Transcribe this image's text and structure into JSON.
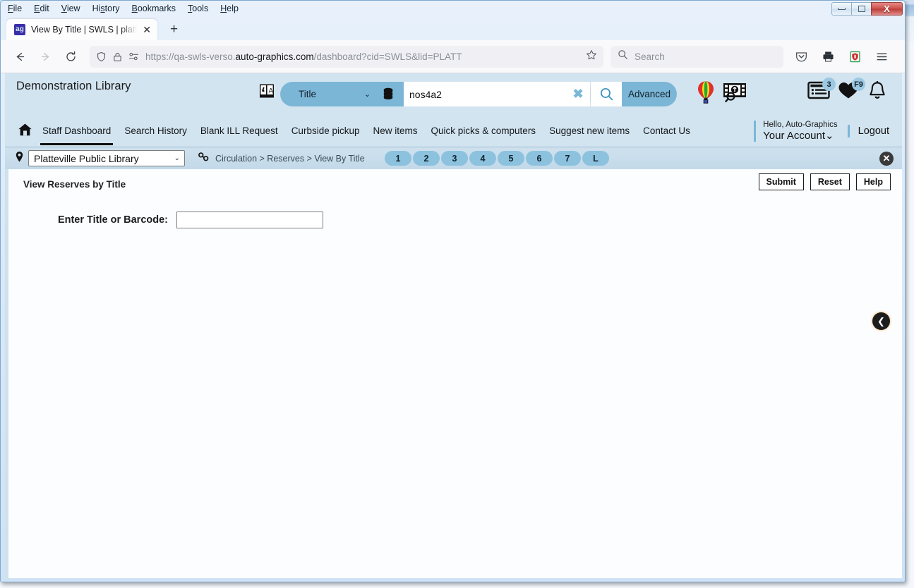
{
  "browser": {
    "menus": [
      "File",
      "Edit",
      "View",
      "History",
      "Bookmarks",
      "Tools",
      "Help"
    ],
    "window_controls": {
      "minimize": "minimize-icon",
      "restore": "restore-icon",
      "close": "X"
    },
    "tab": {
      "title": "View By Title | SWLS | platt | Aut",
      "favicon": "ag-favicon",
      "close": "✕",
      "new_tab": "+"
    },
    "nav": {
      "back": "←",
      "forward": "→",
      "reload": "↻"
    },
    "url": {
      "prefix": "https://qa-swls-verso.",
      "domain": "auto-graphics.com",
      "suffix": "/dashboard?cid=SWLS&lid=PLATT",
      "full": "https://qa-swls-verso.auto-graphics.com/dashboard?cid=SWLS&lid=PLATT"
    },
    "search": {
      "placeholder": "Search"
    },
    "toolbar_icons": [
      "pocket-icon",
      "print-icon",
      "ublock-icon",
      "hamburger-menu-icon"
    ]
  },
  "site": {
    "library_name": "Demonstration Library",
    "translate_icon": "translate-icon",
    "search": {
      "index_label": "Title",
      "caret": "⌄",
      "database_icon": "database-icon",
      "query": "nos4a2",
      "clear_label": "✖",
      "go_icon": "search-icon",
      "advanced_label": "Advanced"
    },
    "header_icons": [
      {
        "name": "balloon-icon",
        "badge": null
      },
      {
        "name": "film-search-icon",
        "badge": null
      },
      {
        "name": "my-lists-icon",
        "badge": "3"
      },
      {
        "name": "favorites-heart-icon",
        "badge": "F9"
      },
      {
        "name": "notifications-bell-icon",
        "badge": null
      }
    ],
    "nav_links": [
      {
        "label": "Staff Dashboard",
        "active": true
      },
      {
        "label": "Search History",
        "active": false
      },
      {
        "label": "Blank ILL Request",
        "active": false
      },
      {
        "label": "Curbside pickup",
        "active": false
      },
      {
        "label": "New items",
        "active": false
      },
      {
        "label": "Quick picks & computers",
        "active": false
      },
      {
        "label": "Suggest new items",
        "active": false
      },
      {
        "label": "Contact Us",
        "active": false
      }
    ],
    "account": {
      "greeting": "Hello, Auto-Graphics",
      "account_label": "Your Account",
      "account_caret": "⌄",
      "logout_label": "Logout"
    }
  },
  "crumbbar": {
    "location_icon": "location-pin-icon",
    "library_select": "Platteville Public Library",
    "select_caret": "⌄",
    "chain_icon": "link-chain-icon",
    "breadcrumb": "Circulation > Reserves > View By Title",
    "page_pills": [
      "1",
      "2",
      "3",
      "4",
      "5",
      "6",
      "7",
      "L"
    ],
    "close_label": "✕"
  },
  "form": {
    "title": "View Reserves by Title",
    "buttons": [
      {
        "label": "Submit",
        "name": "submit-button"
      },
      {
        "label": "Reset",
        "name": "reset-button"
      },
      {
        "label": "Help",
        "name": "help-button"
      }
    ],
    "field_label": "Enter Title or Barcode:",
    "field_value": "",
    "field_placeholder": "",
    "back_button": "❮"
  }
}
